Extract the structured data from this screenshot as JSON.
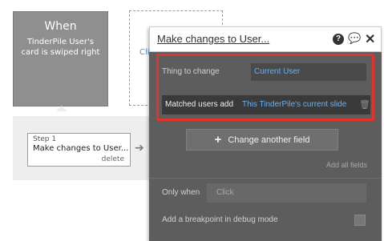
{
  "trigger": {
    "title": "When",
    "description": "TinderPile User's card is swiped right"
  },
  "placeholder": {
    "text": "Cli"
  },
  "step": {
    "label": "Step 1",
    "action": "Make changes to User...",
    "delete_label": "delete"
  },
  "panel": {
    "title": "Make changes to User...",
    "thing_to_change_label": "Thing to change",
    "thing_to_change_value": "Current User",
    "field_label": "Matched users add",
    "field_value": "This TinderPile's current slide",
    "change_field_button": "Change another field",
    "add_all_fields": "Add all fields",
    "only_when_label": "Only when",
    "only_when_placeholder": "Click",
    "breakpoint_label": "Add a breakpoint in debug mode"
  },
  "colors": {
    "highlight": "#e5322b",
    "link": "#6ab0f3",
    "panel_bg": "#5d5d5d"
  }
}
